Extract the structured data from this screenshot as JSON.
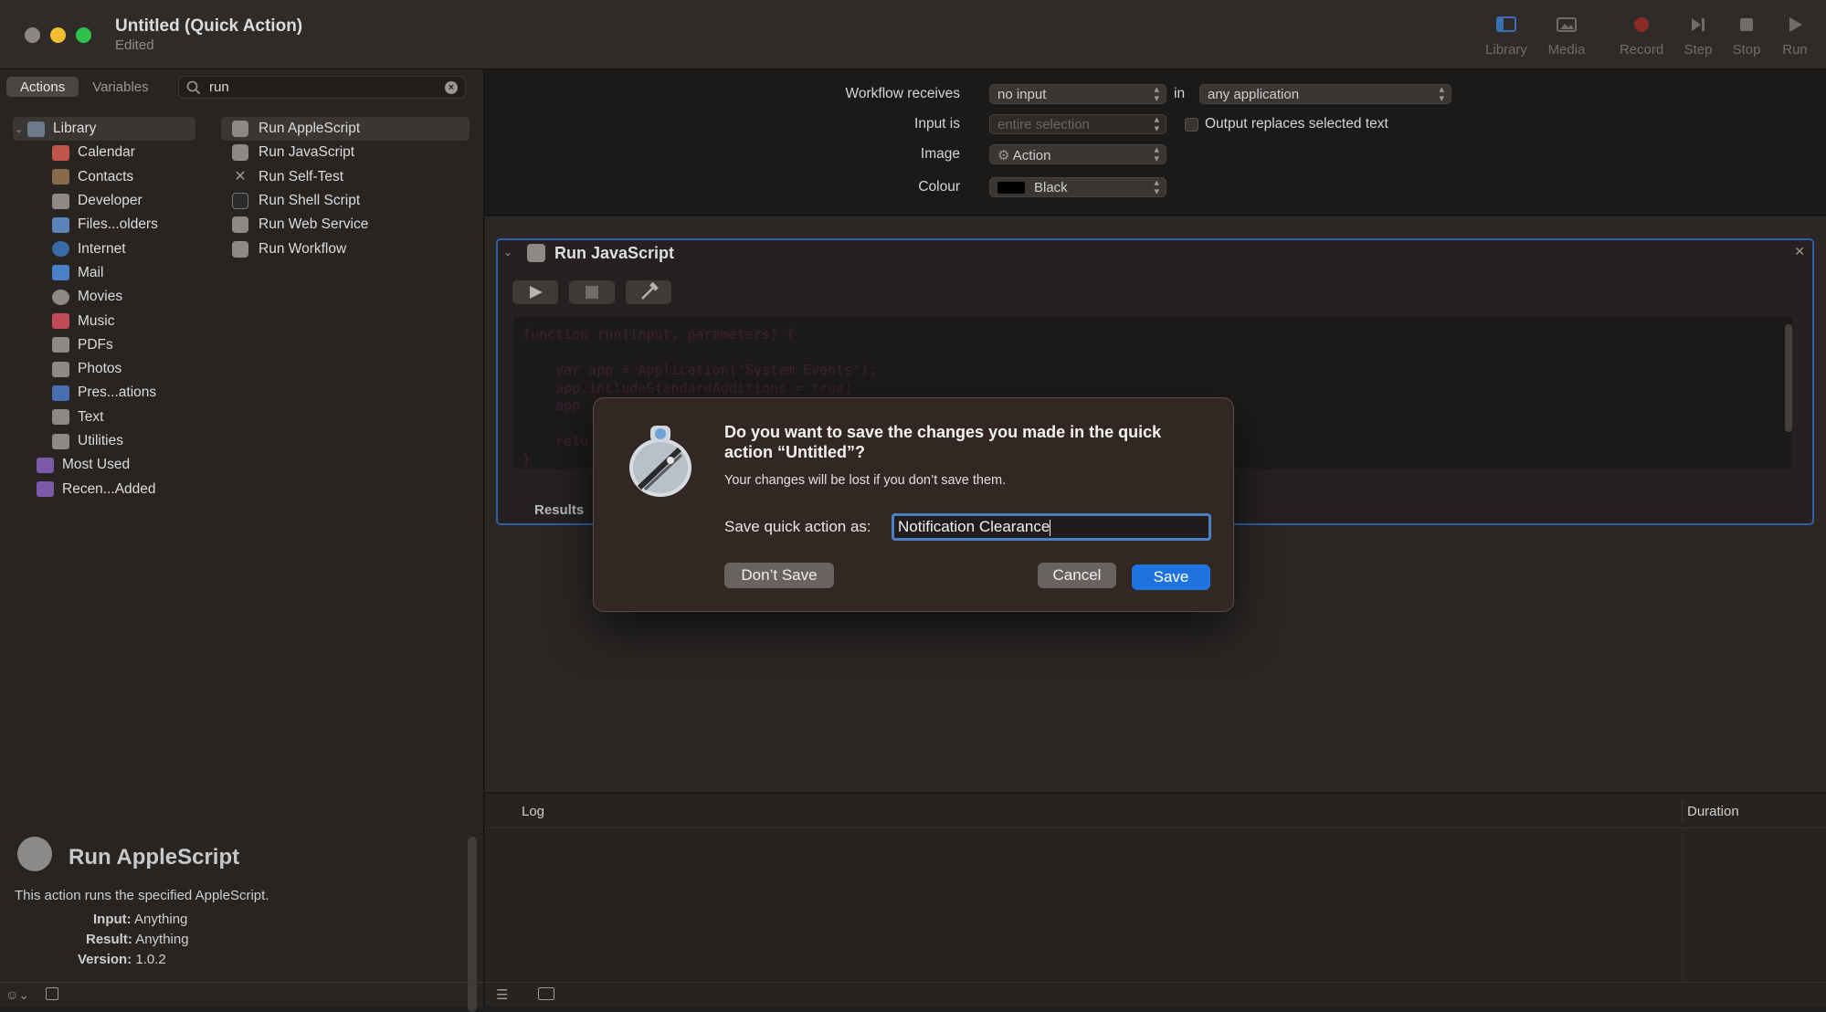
{
  "window": {
    "title": "Untitled (Quick Action)",
    "subtitle": "Edited"
  },
  "toolbar": {
    "library": "Library",
    "media": "Media",
    "record": "Record",
    "step": "Step",
    "stop": "Stop",
    "run": "Run"
  },
  "sidebar": {
    "tabs": {
      "actions": "Actions",
      "variables": "Variables"
    },
    "search_value": "run",
    "library": [
      {
        "label": "Library",
        "color": "#6c7a8a"
      },
      {
        "label": "Calendar",
        "color": "#c1544b"
      },
      {
        "label": "Contacts",
        "color": "#8a6a4a"
      },
      {
        "label": "Developer",
        "color": "#8c8987"
      },
      {
        "label": "Files...olders",
        "color": "#5a84b8"
      },
      {
        "label": "Internet",
        "color": "#3a6aa8"
      },
      {
        "label": "Mail",
        "color": "#4a80c8"
      },
      {
        "label": "Movies",
        "color": "#8c8987"
      },
      {
        "label": "Music",
        "color": "#c04a5a"
      },
      {
        "label": "PDFs",
        "color": "#8c8987"
      },
      {
        "label": "Photos",
        "color": "#8c8987"
      },
      {
        "label": "Pres...ations",
        "color": "#4a6fb0"
      },
      {
        "label": "Text",
        "color": "#8c8987"
      },
      {
        "label": "Utilities",
        "color": "#8c8987"
      },
      {
        "label": "Most Used",
        "color": "#7a5aa8"
      },
      {
        "label": "Recen...Added",
        "color": "#7a5aa8"
      }
    ],
    "actions": [
      "Run AppleScript",
      "Run JavaScript",
      "Run Self-Test",
      "Run Shell Script",
      "Run Web Service",
      "Run Workflow"
    ],
    "info": {
      "title": "Run AppleScript",
      "description": "This action runs the specified AppleScript.",
      "input_label": "Input:",
      "input_value": "Anything",
      "result_label": "Result:",
      "result_value": "Anything",
      "version_label": "Version:",
      "version_value": "1.0.2"
    }
  },
  "workflow": {
    "receives_label": "Workflow receives",
    "receives_value": "no input",
    "in_label": "in",
    "in_value": "any application",
    "input_is_label": "Input is",
    "input_is_value": "entire selection",
    "output_replaces": "Output replaces selected text",
    "image_label": "Image",
    "image_value": "Action",
    "colour_label": "Colour",
    "colour_value": "Black"
  },
  "action": {
    "title": "Run JavaScript",
    "code": "function run(input, parameters) {\n\n    var app = Application('System Events');\n    app.includeStandardAdditions = true;\n    app.\n\n    retu\n}",
    "results_label": "Results"
  },
  "log": {
    "log_label": "Log",
    "duration_label": "Duration"
  },
  "dialog": {
    "title": "Do you want to save the changes you made in the quick action “Untitled”?",
    "message": "Your changes will be lost if you don’t save them.",
    "save_as_label": "Save quick action as:",
    "name_value": "Notification Clearance",
    "dont_save": "Don’t Save",
    "cancel": "Cancel",
    "save": "Save",
    "accent": "#1f73e0"
  }
}
